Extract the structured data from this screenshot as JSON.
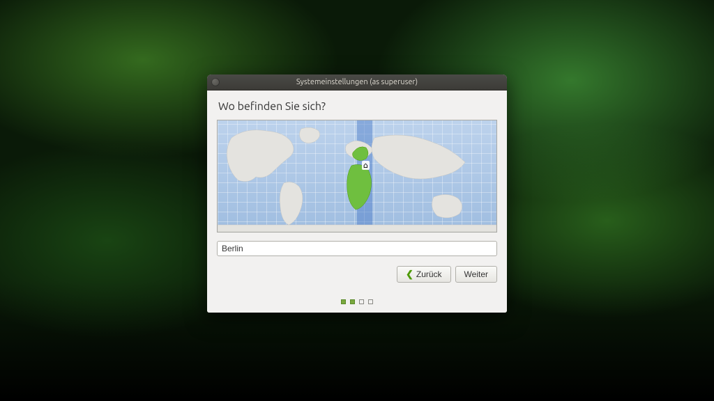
{
  "window": {
    "title": "Systemeinstellungen (as superuser)"
  },
  "page": {
    "heading": "Wo befinden Sie sich?",
    "location_value": "Berlin"
  },
  "buttons": {
    "back": "Zurück",
    "next": "Weiter"
  },
  "progress": {
    "total": 4,
    "completed": 2
  },
  "map": {
    "selected_timezone_band_index": 14
  }
}
